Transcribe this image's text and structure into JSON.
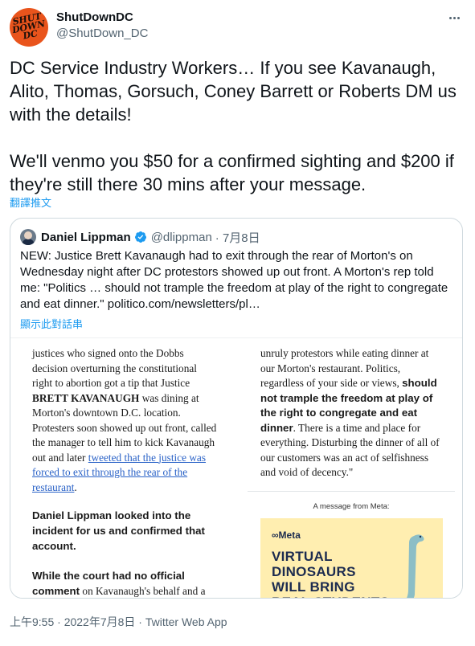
{
  "author": {
    "name": "ShutDownDC",
    "handle": "@ShutDown_DC",
    "avatar_text": "SHUT\nDOWN\nDC"
  },
  "tweet": {
    "paragraphs": [
      "DC Service Industry Workers… If you see Kavanaugh, Alito, Thomas, Gorsuch, Coney Barrett or Roberts DM us with the details!",
      "We'll venmo you $50 for a confirmed sighting and $200 if they're still there 30 mins after your message."
    ],
    "translate_label": "翻譯推文"
  },
  "quote": {
    "author_name": "Daniel Lippman",
    "handle": "@dlippman",
    "date": "· 7月8日",
    "text": "NEW: Justice Brett Kavanaugh had to exit through the rear of Morton's on Wednesday night after DC protestors showed up out front. A Morton's rep told me: \"Politics … should not trample the freedom at play of the right to congregate and eat dinner.\" politico.com/newsletters/pl…",
    "show_thread": "顯示此對話串"
  },
  "article": {
    "left_para1_a": "justices who signed onto the Dobbs decision overturning the constitutional right to abortion got a tip that Justice ",
    "left_para1_bold": "BRETT KAVANAUGH",
    "left_para1_b": " was dining at Morton's downtown D.C. location. Protesters soon showed up out front, called the manager to tell him to kick Kavanaugh out and later ",
    "left_para1_link": "tweeted that the justice was forced to exit through the rear of the restaurant",
    "left_para1_end": ".",
    "left_para2": "Daniel Lippman looked into the incident for us and confirmed that account.",
    "left_para3_bold": "While the court had no official comment",
    "left_para3_rest": " on Kavanaugh's behalf and a",
    "right_para_a": "unruly protestors while eating dinner at our Morton's restaurant. Politics, regardless of your side or views, ",
    "right_para_bold": "should not trample the freedom at play of the right to congregate and eat dinner",
    "right_para_b": ". There is a time and place for everything. Disturbing the dinner of all of our customers was an act of selfishness and void of decency.\"",
    "ad_label": "A message from Meta:",
    "ad_logo": "∞Meta",
    "ad_headline": "VIRTUAL DINOSAURS WILL BRING REAL STUDENTS"
  },
  "footer": {
    "timestamp": "上午9:55 · 2022年7月8日 · Twitter Web App"
  },
  "colors": {
    "link": "#1d9bf0",
    "secondary_text": "#536471",
    "avatar_bg": "#e9541c",
    "ad_bg": "#ffeeb0"
  },
  "icons": [
    "more-options-icon",
    "verified-badge-icon",
    "meta-logo-icon",
    "dinosaur-illustration"
  ]
}
